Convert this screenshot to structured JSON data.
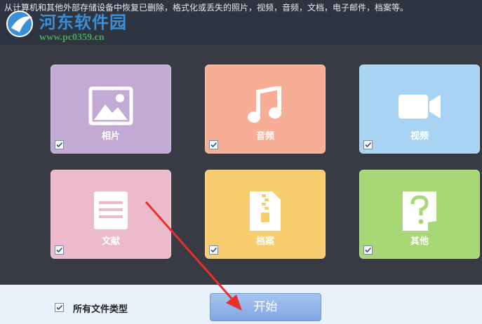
{
  "header": {
    "description": "从计算机和其他外部存储设备中恢复已删除，格式化或丢失的照片，视频，音频，文档，电子邮件，档案等。"
  },
  "watermark": {
    "site_name": "河东软件园",
    "url": "www.pc0359.cn"
  },
  "tiles": [
    {
      "label": "相片",
      "icon": "image-icon",
      "color": "#c3aad4",
      "checked": true
    },
    {
      "label": "音频",
      "icon": "music-note-icon",
      "color": "#f7ad96",
      "checked": true
    },
    {
      "label": "视频",
      "icon": "video-camera-icon",
      "color": "#a9d3f3",
      "checked": true
    },
    {
      "label": "文献",
      "icon": "document-icon",
      "color": "#ecbbcb",
      "checked": true
    },
    {
      "label": "档案",
      "icon": "archive-zip-icon",
      "color": "#f8cd6f",
      "checked": true
    },
    {
      "label": "其他",
      "icon": "question-file-icon",
      "color": "#a8d776",
      "checked": true
    }
  ],
  "footer": {
    "all_types_label": "所有文件类型",
    "all_types_checked": true,
    "start_label": "开始"
  },
  "colors": {
    "header_bg": "#2e3440",
    "main_bg": "#383b44",
    "footer_bg": "#e9f1fb",
    "start_button": "#8fb3ea",
    "annotation_arrow": "#e8302a"
  }
}
